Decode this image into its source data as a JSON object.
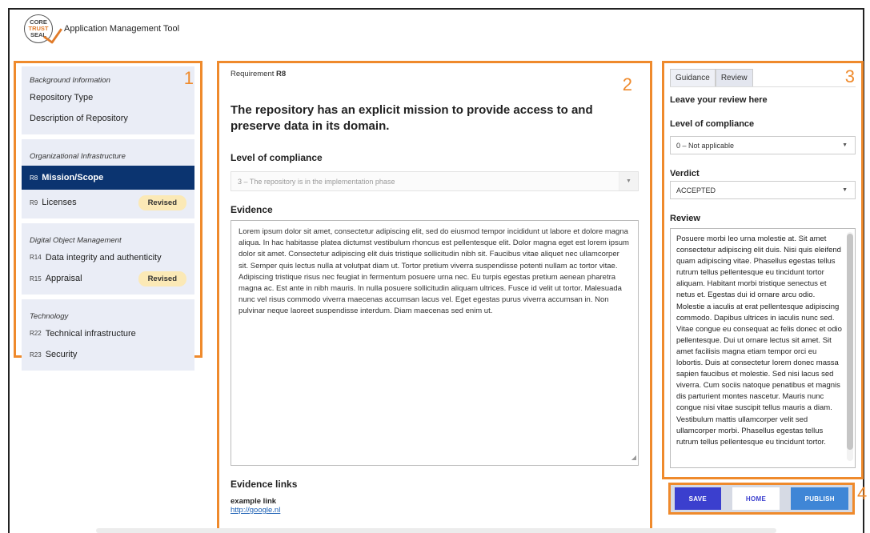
{
  "header": {
    "logo_lines": [
      "CORE",
      "TRUST",
      "SEAL"
    ],
    "app_title": "Application Management Tool"
  },
  "callouts": [
    "1",
    "2",
    "3",
    "4"
  ],
  "sidebar": {
    "groups": [
      {
        "title": "Background Information",
        "items": [
          {
            "code": "",
            "label": "Repository Type"
          },
          {
            "code": "",
            "label": "Description of Repository"
          }
        ]
      },
      {
        "title": "Organizational Infrastructure",
        "items": [
          {
            "code": "R8",
            "label": "Mission/Scope",
            "active": true
          },
          {
            "code": "R9",
            "label": "Licenses",
            "badge": "Revised"
          }
        ]
      },
      {
        "title": "Digital Object Management",
        "items": [
          {
            "code": "R14",
            "label": "Data integrity and authenticity"
          },
          {
            "code": "R15",
            "label": "Appraisal",
            "badge": "Revised"
          }
        ]
      },
      {
        "title": "Technology",
        "items": [
          {
            "code": "R22",
            "label": "Technical infrastructure"
          },
          {
            "code": "R23",
            "label": "Security"
          }
        ]
      }
    ]
  },
  "main": {
    "requirement_prefix": "Requirement",
    "requirement_code": "R8",
    "title": "The repository has an explicit mission to provide access to and preserve data in its domain.",
    "compliance_label": "Level of compliance",
    "compliance_value": "3 – The repository is in the implementation phase",
    "evidence_label": "Evidence",
    "evidence_text": "Lorem ipsum dolor sit amet, consectetur adipiscing elit, sed do eiusmod tempor incididunt ut labore et dolore magna aliqua. In hac habitasse platea dictumst vestibulum rhoncus est pellentesque elit. Dolor magna eget est lorem ipsum dolor sit amet. Consectetur adipiscing elit duis tristique sollicitudin nibh sit. Faucibus vitae aliquet nec ullamcorper sit. Semper quis lectus nulla at volutpat diam ut. Tortor pretium viverra suspendisse potenti nullam ac tortor vitae. Adipiscing tristique risus nec feugiat in fermentum posuere urna nec. Eu turpis egestas pretium aenean pharetra magna ac. Est ante in nibh mauris. In nulla posuere sollicitudin aliquam ultrices. Fusce id velit ut tortor. Malesuada nunc vel risus commodo viverra maecenas accumsan lacus vel. Eget egestas purus viverra accumsan in. Non pulvinar neque laoreet suspendisse interdum. Diam maecenas sed enim ut.",
    "links_label": "Evidence links",
    "link_label": "example link",
    "link_url": "http://google.nl"
  },
  "review": {
    "tabs": [
      "Guidance",
      "Review"
    ],
    "active_tab": "Review",
    "heading": "Leave your review here",
    "compliance_label": "Level of compliance",
    "compliance_value": "0 – Not applicable",
    "verdict_label": "Verdict",
    "verdict_value": "ACCEPTED",
    "review_label": "Review",
    "review_text": "Posuere morbi leo urna molestie at. Sit amet consectetur adipiscing elit duis. Nisi quis eleifend quam adipiscing vitae. Phasellus egestas tellus rutrum tellus pellentesque eu tincidunt tortor aliquam. Habitant morbi tristique senectus et netus et. Egestas dui id ornare arcu odio. Molestie a iaculis at erat pellentesque adipiscing commodo. Dapibus ultrices in iaculis nunc sed. Vitae congue eu consequat ac felis donec et odio pellentesque. Dui ut ornare lectus sit amet. Sit amet facilisis magna etiam tempor orci eu lobortis. Duis at consectetur lorem donec massa sapien faucibus et molestie. Sed nisi lacus sed viverra. Cum sociis natoque penatibus et magnis dis parturient montes nascetur. Mauris nunc congue nisi vitae suscipit tellus mauris a diam. Vestibulum mattis ullamcorper velit sed ullamcorper morbi. Phasellus egestas tellus rutrum tellus pellentesque eu tincidunt tortor."
  },
  "actions": {
    "save": "SAVE",
    "home": "HOME",
    "publish": "PUBLISH"
  },
  "colors": {
    "callout": "#ef8a2c",
    "active_nav": "#0b3470",
    "badge": "#fbe9b6",
    "save_button": "#3b3fce",
    "publish_button": "#3f86d6",
    "sidebar_group_bg": "#eaedf6"
  }
}
